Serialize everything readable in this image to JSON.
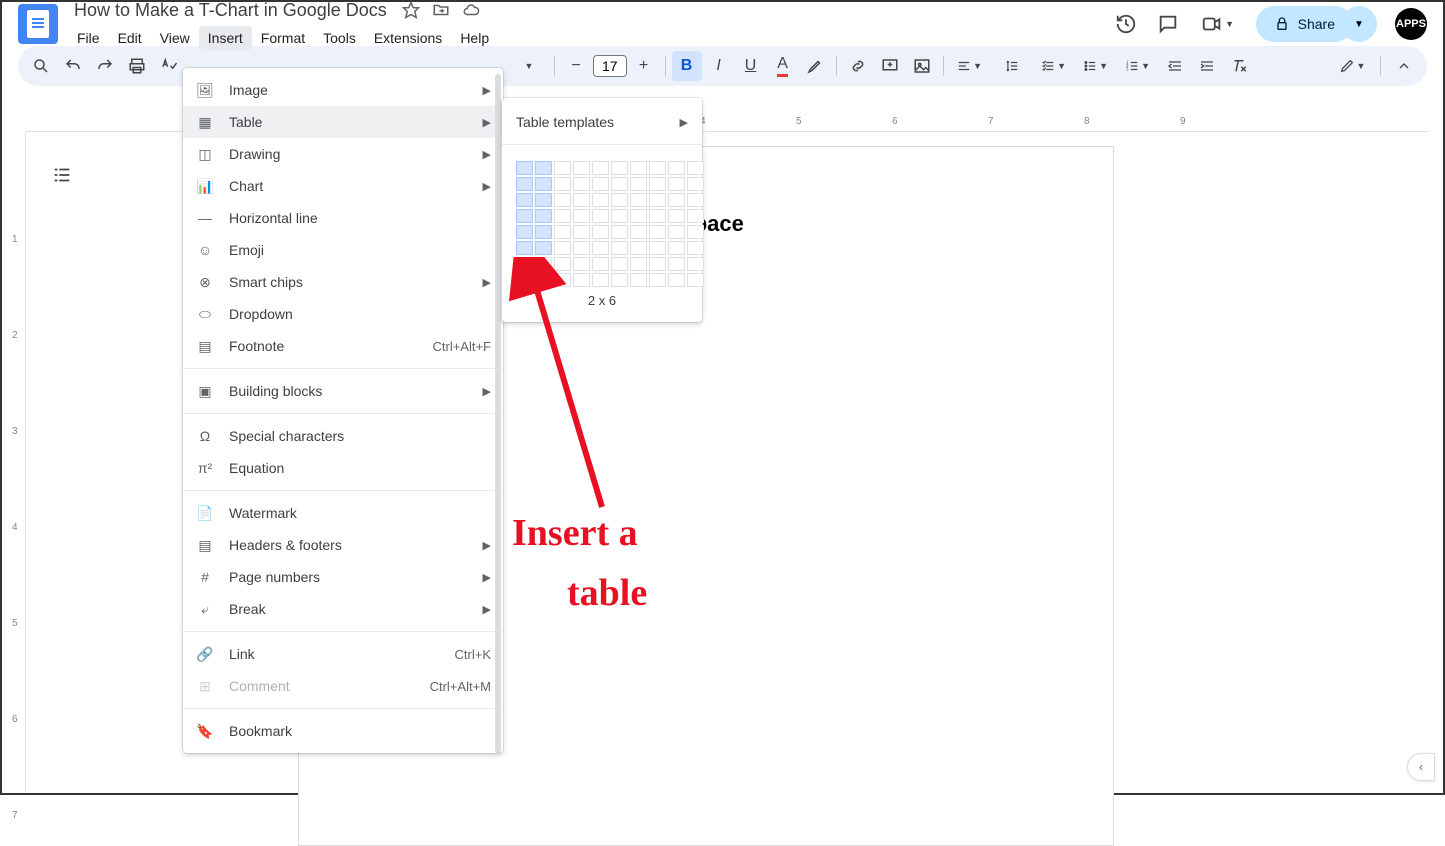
{
  "doc": {
    "title": "How to Make a T-Chart in Google Docs",
    "heading": "Navigating the Virtual Workspace"
  },
  "menus": {
    "file": "File",
    "edit": "Edit",
    "view": "View",
    "insert": "Insert",
    "format": "Format",
    "tools": "Tools",
    "extensions": "Extensions",
    "help": "Help"
  },
  "share": {
    "label": "Share"
  },
  "avatar": {
    "label": "APPS"
  },
  "toolbar": {
    "fontsize": "17"
  },
  "insert_menu": {
    "image": "Image",
    "table": "Table",
    "drawing": "Drawing",
    "chart": "Chart",
    "hline": "Horizontal line",
    "emoji": "Emoji",
    "smartchips": "Smart chips",
    "dropdown": "Dropdown",
    "footnote": "Footnote",
    "footnote_sc": "Ctrl+Alt+F",
    "building": "Building blocks",
    "special": "Special characters",
    "equation": "Equation",
    "watermark": "Watermark",
    "headers": "Headers & footers",
    "pagenum": "Page numbers",
    "break": "Break",
    "link": "Link",
    "link_sc": "Ctrl+K",
    "comment": "Comment",
    "comment_sc": "Ctrl+Alt+M",
    "bookmark": "Bookmark"
  },
  "table_fly": {
    "templates": "Table templates",
    "size": "2 x 6",
    "cols": 2,
    "rows": 6
  },
  "annotation": {
    "line1": "Insert  a",
    "line2": "table"
  }
}
